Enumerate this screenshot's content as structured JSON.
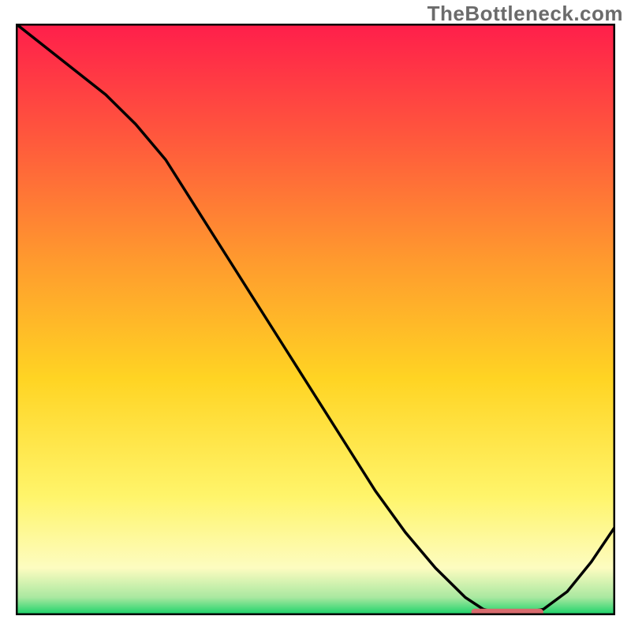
{
  "watermark": "TheBottleneck.com",
  "chart_data": {
    "type": "line",
    "title": "",
    "xlabel": "",
    "ylabel": "",
    "xlim": [
      0,
      100
    ],
    "ylim": [
      0,
      100
    ],
    "x": [
      0,
      5,
      10,
      15,
      20,
      25,
      30,
      35,
      40,
      45,
      50,
      55,
      60,
      65,
      70,
      75,
      78,
      80,
      82,
      85,
      88,
      92,
      96,
      100
    ],
    "values": [
      100,
      96,
      92,
      88,
      83,
      77,
      69,
      61,
      53,
      45,
      37,
      29,
      21,
      14,
      8,
      3,
      1,
      0.5,
      0.5,
      0.5,
      1,
      4,
      9,
      15
    ],
    "optimum_band": {
      "x_start": 76,
      "x_end": 88,
      "y": 0.5
    },
    "gradient_stops": [
      {
        "offset": 0.0,
        "color": "#ff1e4b"
      },
      {
        "offset": 0.2,
        "color": "#ff5a3c"
      },
      {
        "offset": 0.4,
        "color": "#ff9a2e"
      },
      {
        "offset": 0.6,
        "color": "#ffd423"
      },
      {
        "offset": 0.8,
        "color": "#fff56b"
      },
      {
        "offset": 0.92,
        "color": "#fdfcc0"
      },
      {
        "offset": 0.97,
        "color": "#a9e8a0"
      },
      {
        "offset": 1.0,
        "color": "#13d266"
      }
    ],
    "curve_color": "#000000",
    "band_color": "#d86b6e",
    "frame_color": "#000000"
  }
}
